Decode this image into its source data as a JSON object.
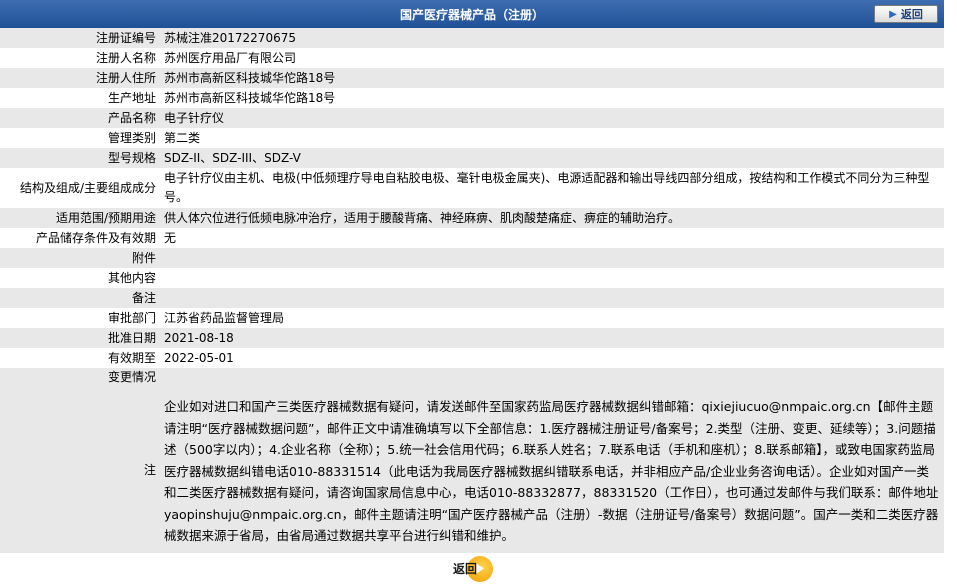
{
  "header": {
    "title": "国产医疗器械产品（注册）",
    "back_label": "返回"
  },
  "rows": [
    {
      "label": "注册证编号",
      "value": "苏械注准20172270675"
    },
    {
      "label": "注册人名称",
      "value": "苏州医疗用品厂有限公司"
    },
    {
      "label": "注册人住所",
      "value": "苏州市高新区科技城华佗路18号"
    },
    {
      "label": "生产地址",
      "value": "苏州市高新区科技城华佗路18号"
    },
    {
      "label": "产品名称",
      "value": "电子针疗仪"
    },
    {
      "label": "管理类别",
      "value": "第二类"
    },
    {
      "label": "型号规格",
      "value": "SDZ-II、SDZ-III、SDZ-V"
    },
    {
      "label": "结构及组成/主要组成成分",
      "value": "电子针疗仪由主机、电极(中低频理疗导电自粘胶电极、毫针电极金属夹)、电源适配器和输出导线四部分组成，按结构和工作模式不同分为三种型号。"
    },
    {
      "label": "适用范围/预期用途",
      "value": "供人体穴位进行低频电脉冲治疗，适用于腰酸背痛、神经麻痹、肌肉酸楚痛症、痹症的辅助治疗。"
    },
    {
      "label": "产品储存条件及有效期",
      "value": "无"
    },
    {
      "label": "附件",
      "value": ""
    },
    {
      "label": "其他内容",
      "value": ""
    },
    {
      "label": "备注",
      "value": ""
    },
    {
      "label": "审批部门",
      "value": "江苏省药品监督管理局"
    },
    {
      "label": "批准日期",
      "value": "2021-08-18"
    },
    {
      "label": "有效期至",
      "value": "2022-05-01"
    },
    {
      "label": "变更情况",
      "value": ""
    }
  ],
  "note": {
    "label": "注",
    "text": "企业如对进口和国产三类医疗器械数据有疑问，请发送邮件至国家药监局医疗器械数据纠错邮箱：qixiejiucuo@nmpaic.org.cn【邮件主题请注明“医疗器械数据问题”，邮件正文中请准确填写以下全部信息：1.医疗器械注册证号/备案号；2.类型（注册、变更、延续等）；3.问题描述（500字以内）；4.企业名称（全称）；5.统一社会信用代码；6.联系人姓名；7.联系电话（手机和座机）；8.联系邮箱】，或致电国家药监局医疗器械数据纠错电话010-88331514（此电话为我局医疗器械数据纠错联系电话，并非相应产品/企业业务咨询电话）。企业如对国产一类和二类医疗器械数据有疑问，请咨询国家局信息中心，电话010-88332877，88331520（工作日），也可通过发邮件与我们联系：邮件地址yaopinshuju@nmpaic.org.cn，邮件主题请注明“国产医疗器械产品（注册）-数据（注册证号/备案号）数据问题”。国产一类和二类医疗器械数据来源于省局，由省局通过数据共享平台进行纠错和维护。"
  },
  "footer": {
    "back_label": "返回"
  }
}
